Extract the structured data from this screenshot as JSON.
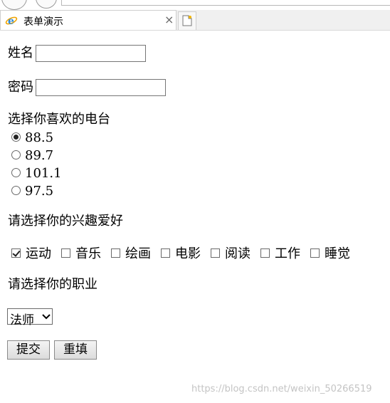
{
  "tab": {
    "title": "表单演示",
    "close": "×"
  },
  "form": {
    "name_label": "姓名",
    "name_value": "",
    "password_label": "密码",
    "password_value": "",
    "radio_prompt": "选择你喜欢的电台",
    "radios": [
      {
        "label": "88.5",
        "checked": true
      },
      {
        "label": "89.7",
        "checked": false
      },
      {
        "label": "101.1",
        "checked": false
      },
      {
        "label": "97.5",
        "checked": false
      }
    ],
    "hobby_prompt": "请选择你的兴趣爱好",
    "hobbies": [
      {
        "label": "运动",
        "checked": true
      },
      {
        "label": "音乐",
        "checked": false
      },
      {
        "label": "绘画",
        "checked": false
      },
      {
        "label": "电影",
        "checked": false
      },
      {
        "label": "阅读",
        "checked": false
      },
      {
        "label": "工作",
        "checked": false
      },
      {
        "label": "睡觉",
        "checked": false
      }
    ],
    "job_prompt": "请选择你的职业",
    "job_selected": "法师",
    "submit_label": "提交",
    "reset_label": "重填"
  },
  "watermark": "https://blog.csdn.net/weixin_50266519"
}
